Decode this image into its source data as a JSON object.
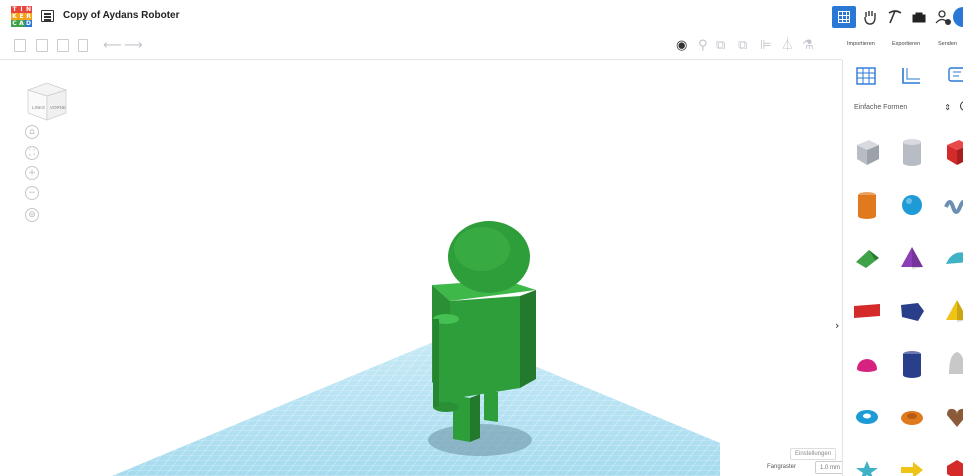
{
  "app": {
    "logo_letters": [
      "T",
      "I",
      "N",
      "K",
      "E",
      "R",
      "C",
      "A",
      "D"
    ],
    "logo_colors": [
      "#e8453c",
      "#e8453c",
      "#e8453c",
      "#f3a31a",
      "#f3a31a",
      "#f3a31a",
      "#3fa249",
      "#3fa249",
      "#2a78d6"
    ],
    "document_title": "Copy of Aydans Roboter"
  },
  "topbar": {
    "import_label": "Importieren",
    "export_label": "Exportieren",
    "send_label": "Senden"
  },
  "panel": {
    "category": "Einfache Formen",
    "shapes": [
      {
        "name": "box-striped",
        "color": "#b8bcc4"
      },
      {
        "name": "cylinder-striped",
        "color": "#b8bcc4"
      },
      {
        "name": "box",
        "color": "#d42a2a"
      },
      {
        "name": "cylinder",
        "color": "#e07a1f"
      },
      {
        "name": "sphere",
        "color": "#1e9ad6"
      },
      {
        "name": "scribble",
        "color": "#6a8fb0"
      },
      {
        "name": "roof",
        "color": "#3fa249"
      },
      {
        "name": "cone",
        "color": "#8a3fb6"
      },
      {
        "name": "round-roof",
        "color": "#3fb2c6"
      },
      {
        "name": "text",
        "color": "#d42a2a"
      },
      {
        "name": "polygon",
        "color": "#2a3f8a"
      },
      {
        "name": "pyramid",
        "color": "#f0c416"
      },
      {
        "name": "half-sphere",
        "color": "#d6237f"
      },
      {
        "name": "polygon-prism",
        "color": "#2a3f8a"
      },
      {
        "name": "paraboloid",
        "color": "#c8c8c8"
      },
      {
        "name": "torus",
        "color": "#1e9ad6"
      },
      {
        "name": "tube",
        "color": "#e07a1f"
      },
      {
        "name": "heart",
        "color": "#8a5a3a"
      },
      {
        "name": "star",
        "color": "#3fb2c6"
      },
      {
        "name": "arrow",
        "color": "#f0c416"
      },
      {
        "name": "gem",
        "color": "#d42a2a"
      }
    ]
  },
  "viewport": {
    "viewcube_front": "VORNE",
    "viewcube_left": "LINKS",
    "settings_label": "Einstellungen",
    "snap_label": "Fangraster",
    "snap_value": "1.0 mm ▾",
    "model_color": "#2e9e3a",
    "workplane_color": "#a8dcef"
  }
}
